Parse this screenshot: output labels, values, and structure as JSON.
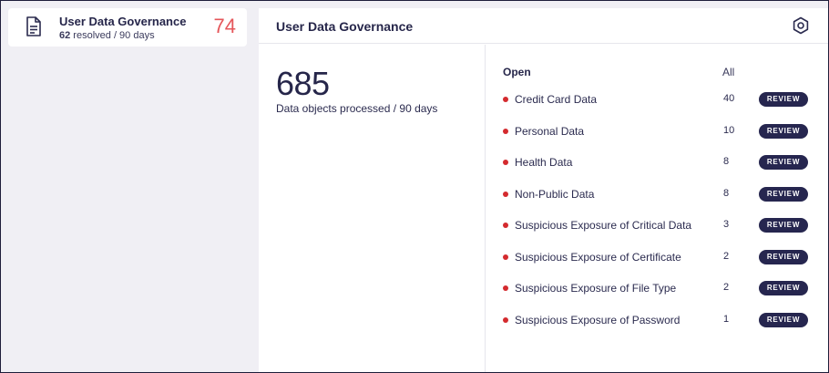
{
  "summary_card": {
    "title": "User Data Governance",
    "resolved_count": "62",
    "resolved_suffix": " resolved / 90 days",
    "open_count": "74",
    "icon": "document-icon"
  },
  "panel": {
    "title": "User Data Governance",
    "settings_icon": "settings-icon",
    "total_value": "685",
    "total_label": "Data objects processed / 90 days",
    "list_header_open": "Open",
    "list_header_all": "All",
    "review_label": "REVIEW",
    "items": [
      {
        "label": "Credit Card Data",
        "count": "40"
      },
      {
        "label": "Personal Data",
        "count": "10"
      },
      {
        "label": "Health Data",
        "count": "8"
      },
      {
        "label": "Non-Public Data",
        "count": "8"
      },
      {
        "label": "Suspicious Exposure of Critical Data",
        "count": "3"
      },
      {
        "label": "Suspicious Exposure of Certificate",
        "count": "2"
      },
      {
        "label": "Suspicious Exposure of File Type",
        "count": "2"
      },
      {
        "label": "Suspicious Exposure of Password",
        "count": "1"
      }
    ]
  },
  "colors": {
    "accent_count": "#e5565a",
    "status_dot": "#d42a2e",
    "review_button": "#26264f",
    "text_primary": "#26264a",
    "background": "#f0eff4"
  }
}
